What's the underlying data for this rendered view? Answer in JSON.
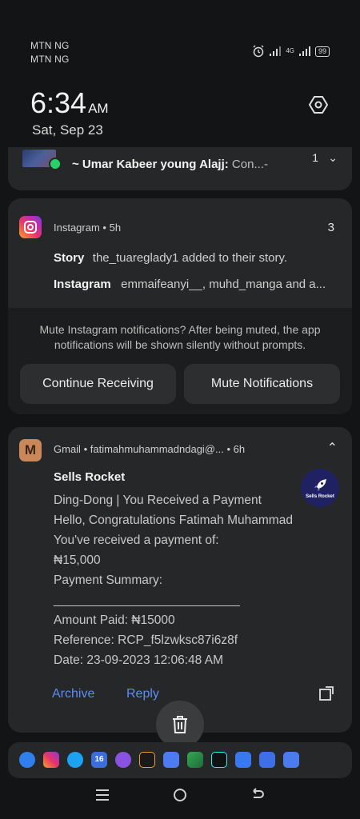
{
  "status_bar": {
    "carrier_1": "MTN NG",
    "carrier_2": "MTN NG",
    "network_type": "4G",
    "battery": "99"
  },
  "clock": {
    "time": "6:34",
    "ampm": "AM",
    "date": "Sat, Sep 23"
  },
  "whatsapp": {
    "sender": "~ Umar Kabeer young Alajj:",
    "preview": "Con...-",
    "count": "1"
  },
  "instagram": {
    "app_name": "Instagram",
    "time": "5h",
    "count": "3",
    "rows": [
      {
        "title": "Story",
        "text": "the_tuareglady1 added to their story."
      },
      {
        "title": "Instagram",
        "text": "emmaifeanyi__, muhd_manga and a..."
      }
    ],
    "mute_message": "Mute Instagram notifications? After being muted, the app notifications will be shown silently without prompts.",
    "continue_label": "Continue Receiving",
    "mute_label": "Mute Notifications"
  },
  "gmail": {
    "app_name": "Gmail",
    "account": "fatimahmuhammadndagi@...",
    "time": "6h",
    "sender": "Sells Rocket",
    "lines": [
      "Ding-Dong | You Received a Payment",
      "Hello, Congratulations Fatimah Muhammad",
      "You've received a payment of:",
      "₦15,000",
      "Payment Summary:",
      "___________________________",
      "Amount Paid: ₦15000",
      "Reference: RCP_f5lzwksc87i6z8f",
      "Date: 23-09-2023 12:06:48 AM"
    ],
    "avatar_label": "Sells Rocket",
    "archive_label": "Archive",
    "reply_label": "Reply"
  },
  "dock": {
    "icons": [
      "messages-icon",
      "instagram-icon",
      "twitter-icon",
      "calendar-icon",
      "podcast-icon",
      "audiomack-icon",
      "gmail-icon",
      "maps-icon",
      "tiktok-icon",
      "gallery-icon",
      "google-icon",
      "play-icon"
    ],
    "calendar_day": "16"
  },
  "colors": {
    "accent": "#5b8ef5",
    "card": "#262728",
    "background": "#131415"
  }
}
